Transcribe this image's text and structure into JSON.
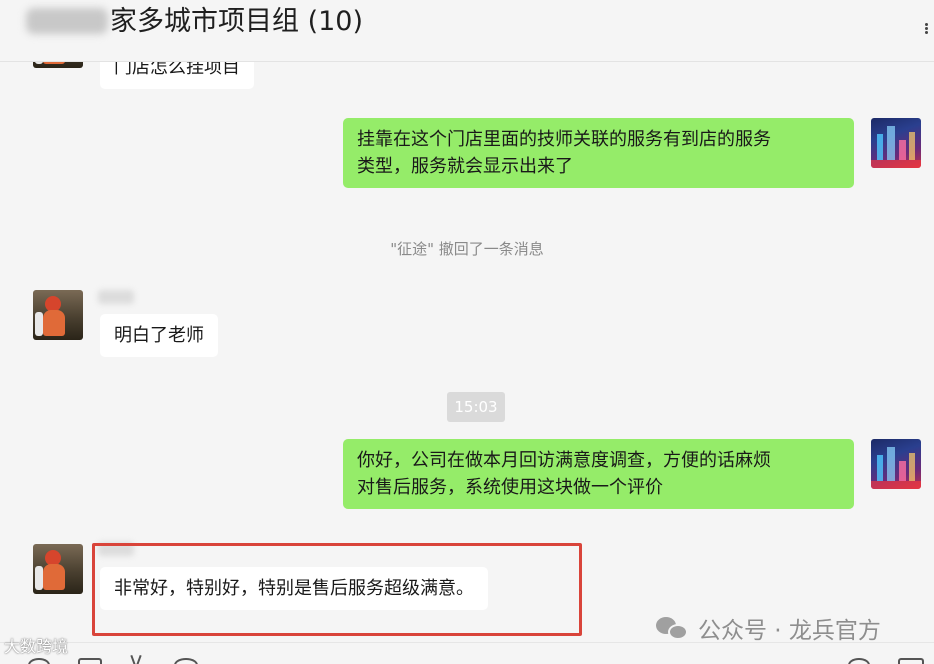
{
  "header": {
    "title_visible": "家多城市项目组 (10)"
  },
  "messages": {
    "m1_text": "门店怎么挂项目",
    "m2_text_line1": "挂靠在这个门店里面的技师关联的服务有到店的服务",
    "m2_text_line2": "类型，服务就会显示出来了",
    "recall_note": "\"征途\" 撤回了一条消息",
    "m3_text": "明白了老师",
    "time": "15:03",
    "m4_text_line1": "你好，公司在做本月回访满意度调查，方便的话麻烦",
    "m4_text_line2": "对售后服务，系统使用这块做一个评价",
    "m5_text": "非常好，特别好，特别是售后服务超级满意。"
  },
  "watermark": {
    "text": "公众号 · 龙兵官方"
  },
  "corner_watermark": {
    "text": "大数跨境"
  },
  "icons": [
    "more-icon",
    "emoji-icon",
    "folder-icon",
    "scissors-icon",
    "chat-icon",
    "phone-icon",
    "video-icon",
    "wechat-icon"
  ],
  "colors": {
    "background": "#f5f5f5",
    "self_bubble": "#95ec69",
    "other_bubble": "#ffffff",
    "highlight_border": "#d9443a"
  }
}
